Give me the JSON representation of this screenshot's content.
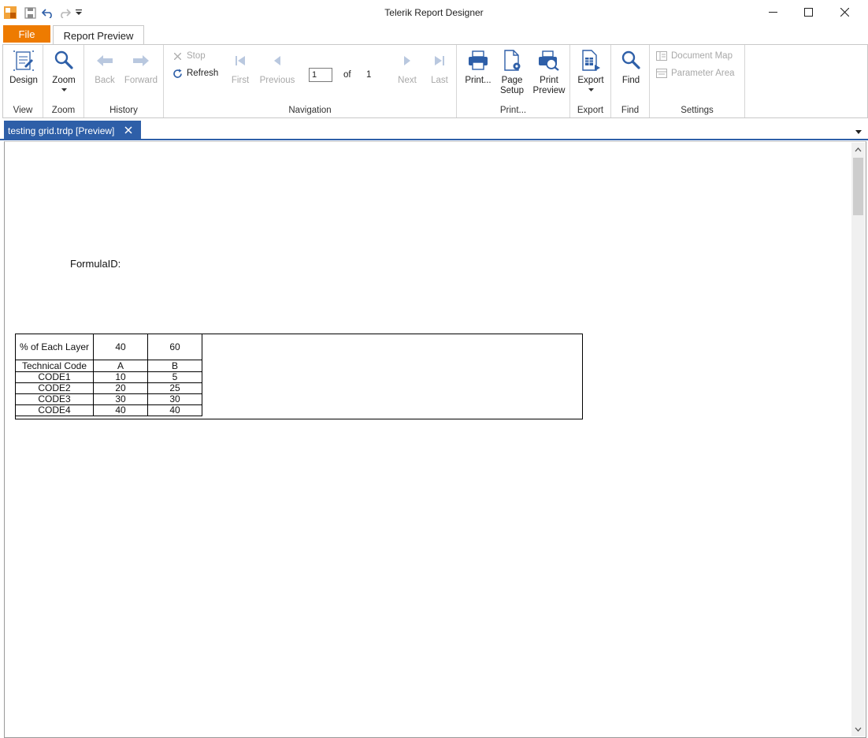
{
  "window": {
    "title": "Telerik Report Designer"
  },
  "tabs": {
    "file": "File",
    "report_preview": "Report Preview"
  },
  "ribbon": {
    "view": {
      "label": "View",
      "design": "Design"
    },
    "zoom": {
      "label": "Zoom",
      "zoom": "Zoom"
    },
    "history": {
      "label": "History",
      "back": "Back",
      "forward": "Forward"
    },
    "navigation": {
      "label": "Navigation",
      "stop": "Stop",
      "refresh": "Refresh",
      "first": "First",
      "previous": "Previous",
      "page_value": "1",
      "of": "of",
      "total_pages": "1",
      "next": "Next",
      "last": "Last"
    },
    "print": {
      "label": "Print...",
      "print": "Print...",
      "page_setup_1": "Page",
      "page_setup_2": "Setup",
      "print_preview_1": "Print",
      "print_preview_2": "Preview"
    },
    "export": {
      "label": "Export",
      "export": "Export"
    },
    "find": {
      "label": "Find",
      "find": "Find"
    },
    "settings": {
      "label": "Settings",
      "document_map": "Document Map",
      "parameter_area": "Parameter Area"
    }
  },
  "document_tab": {
    "label": "testing grid.trdp [Preview]"
  },
  "report": {
    "formula_label": "FormulaID:",
    "header_row1": [
      "% of Each Layer",
      "40",
      "60"
    ],
    "header_row2": [
      "Technical Code",
      "A",
      "B"
    ],
    "rows": [
      [
        "CODE1",
        "10",
        "5"
      ],
      [
        "CODE2",
        "20",
        "25"
      ],
      [
        "CODE3",
        "30",
        "30"
      ],
      [
        "CODE4",
        "40",
        "40"
      ]
    ]
  },
  "colors": {
    "file_tab": "#ee7b00",
    "doc_tab": "#2e5fa8",
    "icon_blue": "#2e5fa8"
  }
}
